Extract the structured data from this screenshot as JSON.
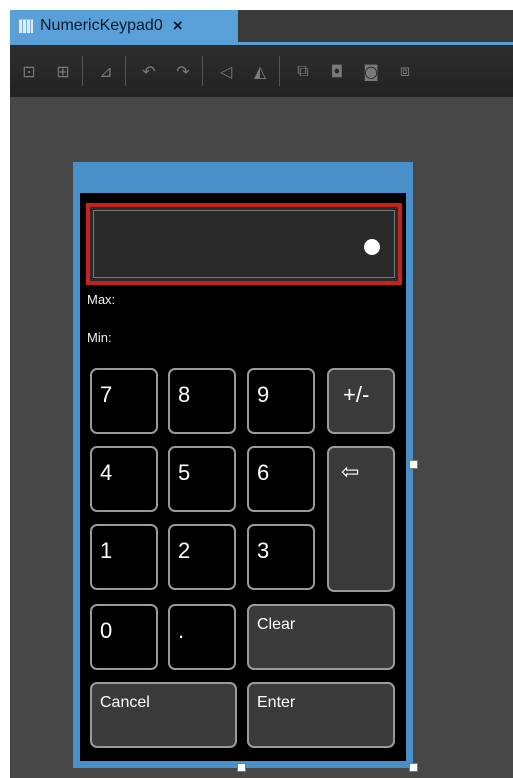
{
  "tab": {
    "title": "NumericKeypad0",
    "close": "×"
  },
  "toolbar": {
    "icons": [
      "align-left-icon",
      "align-center-icon",
      "align-right-icon",
      "rotate-left-icon",
      "rotate-right-icon",
      "flip-horizontal-icon",
      "flip-vertical-icon",
      "bring-forward-icon",
      "send-backward-icon",
      "bring-to-front-icon",
      "send-to-back-icon"
    ]
  },
  "keypad": {
    "display_value": "",
    "max_label": "Max:",
    "min_label": "Min:",
    "keys": {
      "k7": "7",
      "k8": "8",
      "k9": "9",
      "plusminus": "+/-",
      "k4": "4",
      "k5": "5",
      "k6": "6",
      "backspace": "⇦",
      "k1": "1",
      "k2": "2",
      "k3": "3",
      "k0": "0",
      "dot": ".",
      "clear": "Clear",
      "cancel": "Cancel",
      "enter": "Enter"
    }
  },
  "colors": {
    "accent": "#5aa0d8",
    "display_border": "#c62020",
    "canvas": "#474747"
  }
}
